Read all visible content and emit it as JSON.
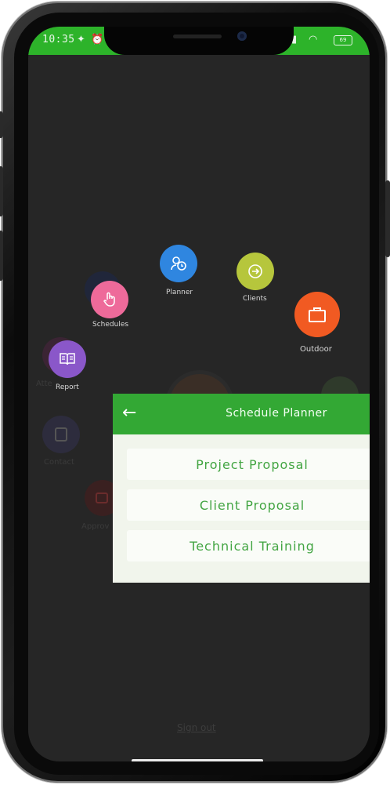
{
  "status_bar": {
    "time": "10:35",
    "battery": "69"
  },
  "menu": {
    "planner": "Planner",
    "clients": "Clients",
    "outdoor": "Outdoor",
    "schedules": "Schedules",
    "report": "Report",
    "contact": "Contact",
    "approval": "Approv",
    "attendance": "Atte"
  },
  "dialog": {
    "title": "Schedule Planner",
    "options": [
      {
        "label": "Project Proposal"
      },
      {
        "label": "Client Proposal"
      },
      {
        "label": "Technical Training"
      }
    ]
  },
  "footer": {
    "signout": "Sign out"
  },
  "colors": {
    "status_bar": "#2db32a",
    "dialog_header": "#33a834",
    "option_text": "#43a543"
  }
}
